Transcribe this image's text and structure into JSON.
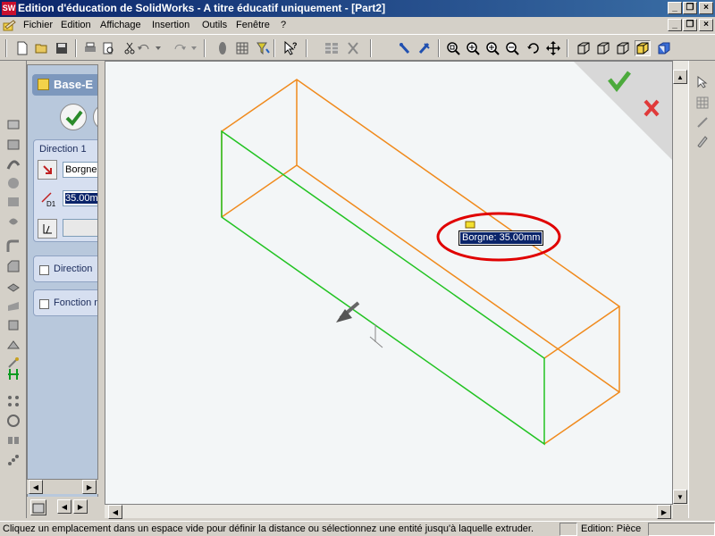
{
  "window": {
    "title": "Edition d'éducation de SolidWorks - A titre éducatif uniquement - [Part2]",
    "app_icon": "SW",
    "controls": [
      "_",
      "❐",
      "×"
    ]
  },
  "menu": {
    "items": [
      "Fichier",
      "Edition",
      "Affichage",
      "Insertion",
      "Outils",
      "Fenêtre",
      "?"
    ]
  },
  "property_manager": {
    "title": "Base-E",
    "direction1": {
      "title": "Direction 1",
      "end_condition": "Borgne",
      "depth": "35.00m"
    },
    "direction2_label": "Direction",
    "thin_feature_label": "Fonction m"
  },
  "viewport": {
    "dimension_callout": "Borgne: 35.00mm",
    "accept_color": "#4caa3c",
    "cancel_color": "#e03a3a",
    "highlight_circle_color": "#e00000",
    "edge_color_preview": "#f08a1c",
    "edge_color_selected": "#22c322"
  },
  "status": {
    "message": "Cliquez un emplacement dans un espace vide pour définir la distance ou sélectionnez une entité jusqu'à laquelle extruder.",
    "mode": "Edition: Pièce"
  },
  "icons": {
    "toolbar": [
      "new-icon",
      "open-icon",
      "save-icon",
      "print-icon",
      "print-preview-icon",
      "cut-icon",
      "copy-icon",
      "paste-icon",
      "undo-icon",
      "redo-icon",
      "select-icon",
      "sketch-grid-icon",
      "filter-icon",
      "help-pointer-icon",
      "table-icon",
      "rebuild-icon",
      "measure-icon",
      "mass-icon",
      "zoom-fit-icon",
      "zoom-area-icon",
      "zoom-in-out-icon",
      "zoom-selection-icon",
      "rotate-icon",
      "pan-icon",
      "isometric-icon",
      "wireframe-icon",
      "hidden-lines-icon",
      "shaded-edges-icon",
      "shaded-icon"
    ]
  }
}
